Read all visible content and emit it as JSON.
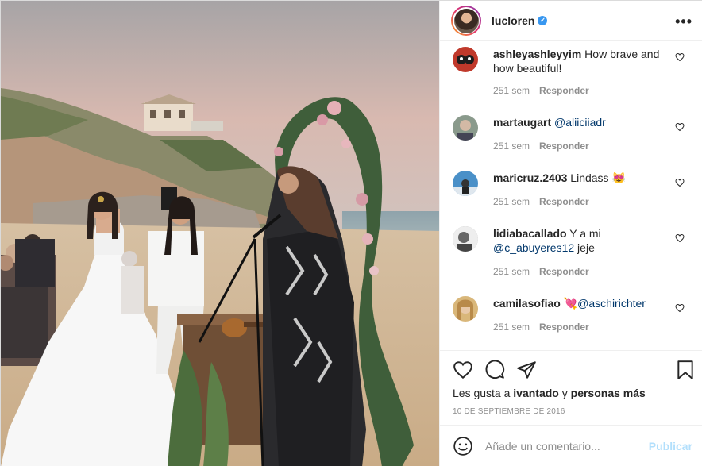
{
  "post": {
    "owner": "lucloren",
    "verified_mark": "✓"
  },
  "comments": [
    {
      "user": "ashleyashleyyim",
      "text": " How brave and how beautiful!",
      "mention": "",
      "time": "251 sem",
      "reply": "Responder",
      "avatar_color": "#c0392b"
    },
    {
      "user": "martaugart",
      "text": " ",
      "mention": "@aliiciiadr",
      "time": "251 sem",
      "reply": "Responder",
      "avatar_color": "#8a9a8c"
    },
    {
      "user": "maricruz.2403",
      "text": " Lindass 😻",
      "mention": "",
      "time": "251 sem",
      "reply": "Responder",
      "avatar_color": "#4a90c8"
    },
    {
      "user": "lidiabacallado",
      "text": " Y a mi ",
      "mention": "@c_abuyeres12",
      "suffix": " jeje",
      "time": "251 sem",
      "reply": "Responder",
      "avatar_color": "#9a9a9a"
    },
    {
      "user": "camilasofiao",
      "text": " 💘",
      "mention": "@aschirichter",
      "time": "251 sem",
      "reply": "Responder",
      "avatar_color": "#d9b77a"
    }
  ],
  "actions": {
    "likes_prefix": "Les gusta a ",
    "likes_user": "ivantado",
    "likes_and": " y ",
    "likes_rest": "personas más",
    "date": "10 DE SEPTIEMBRE DE 2016"
  },
  "add_comment": {
    "placeholder": "Añade un comentario...",
    "post_label": "Publicar"
  },
  "icons": [
    "more-options-icon",
    "heart-icon",
    "comment-icon",
    "share-icon",
    "bookmark-icon",
    "emoji-icon",
    "verified-badge-icon"
  ]
}
